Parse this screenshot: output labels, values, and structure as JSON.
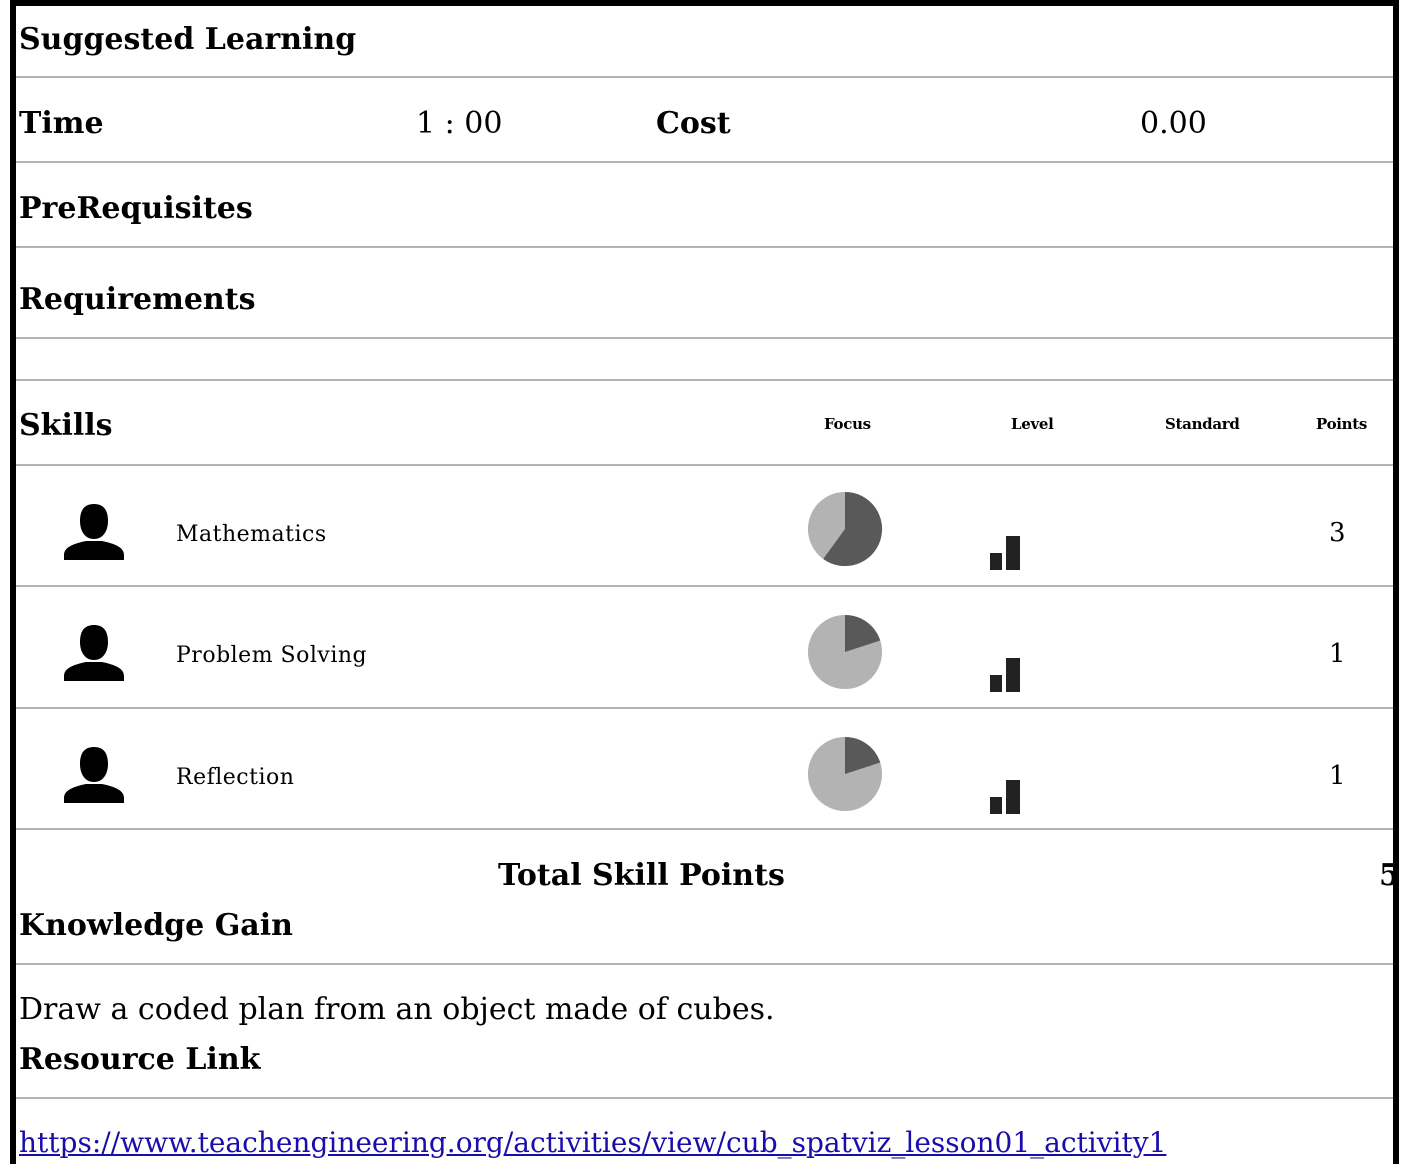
{
  "suggested_learning": {
    "title": "Suggested Learning"
  },
  "time": {
    "label": "Time",
    "value": "1 : 00"
  },
  "cost": {
    "label": "Cost",
    "value": "0.00"
  },
  "prerequisites": {
    "label": "PreRequisites"
  },
  "requirements": {
    "label": "Requirements"
  },
  "skills": {
    "label": "Skills",
    "columns": {
      "focus": "Focus",
      "level": "Level",
      "standard": "Standard",
      "points": "Points"
    },
    "items": [
      {
        "name": "Mathematics",
        "icon": "user-icon",
        "focus_fraction": 0.6,
        "level": 2,
        "points": "3"
      },
      {
        "name": "Problem Solving",
        "icon": "user-icon",
        "focus_fraction": 0.2,
        "level": 2,
        "points": "1"
      },
      {
        "name": "Reflection",
        "icon": "user-icon",
        "focus_fraction": 0.2,
        "level": 2,
        "points": "1"
      }
    ],
    "total_label": "Total Skill Points",
    "total_value": "5"
  },
  "knowledge_gain": {
    "label": "Knowledge Gain",
    "text": "Draw a coded plan from an object made of cubes."
  },
  "resource_link": {
    "label": "Resource Link",
    "url": "https://www.teachengineering.org/activities/view/cub_spatviz_lesson01_activity1"
  },
  "colors": {
    "pie_dark": "#595959",
    "pie_light": "#b3b3b3",
    "rule": "#b4b4b4",
    "link": "#1a0dab"
  }
}
